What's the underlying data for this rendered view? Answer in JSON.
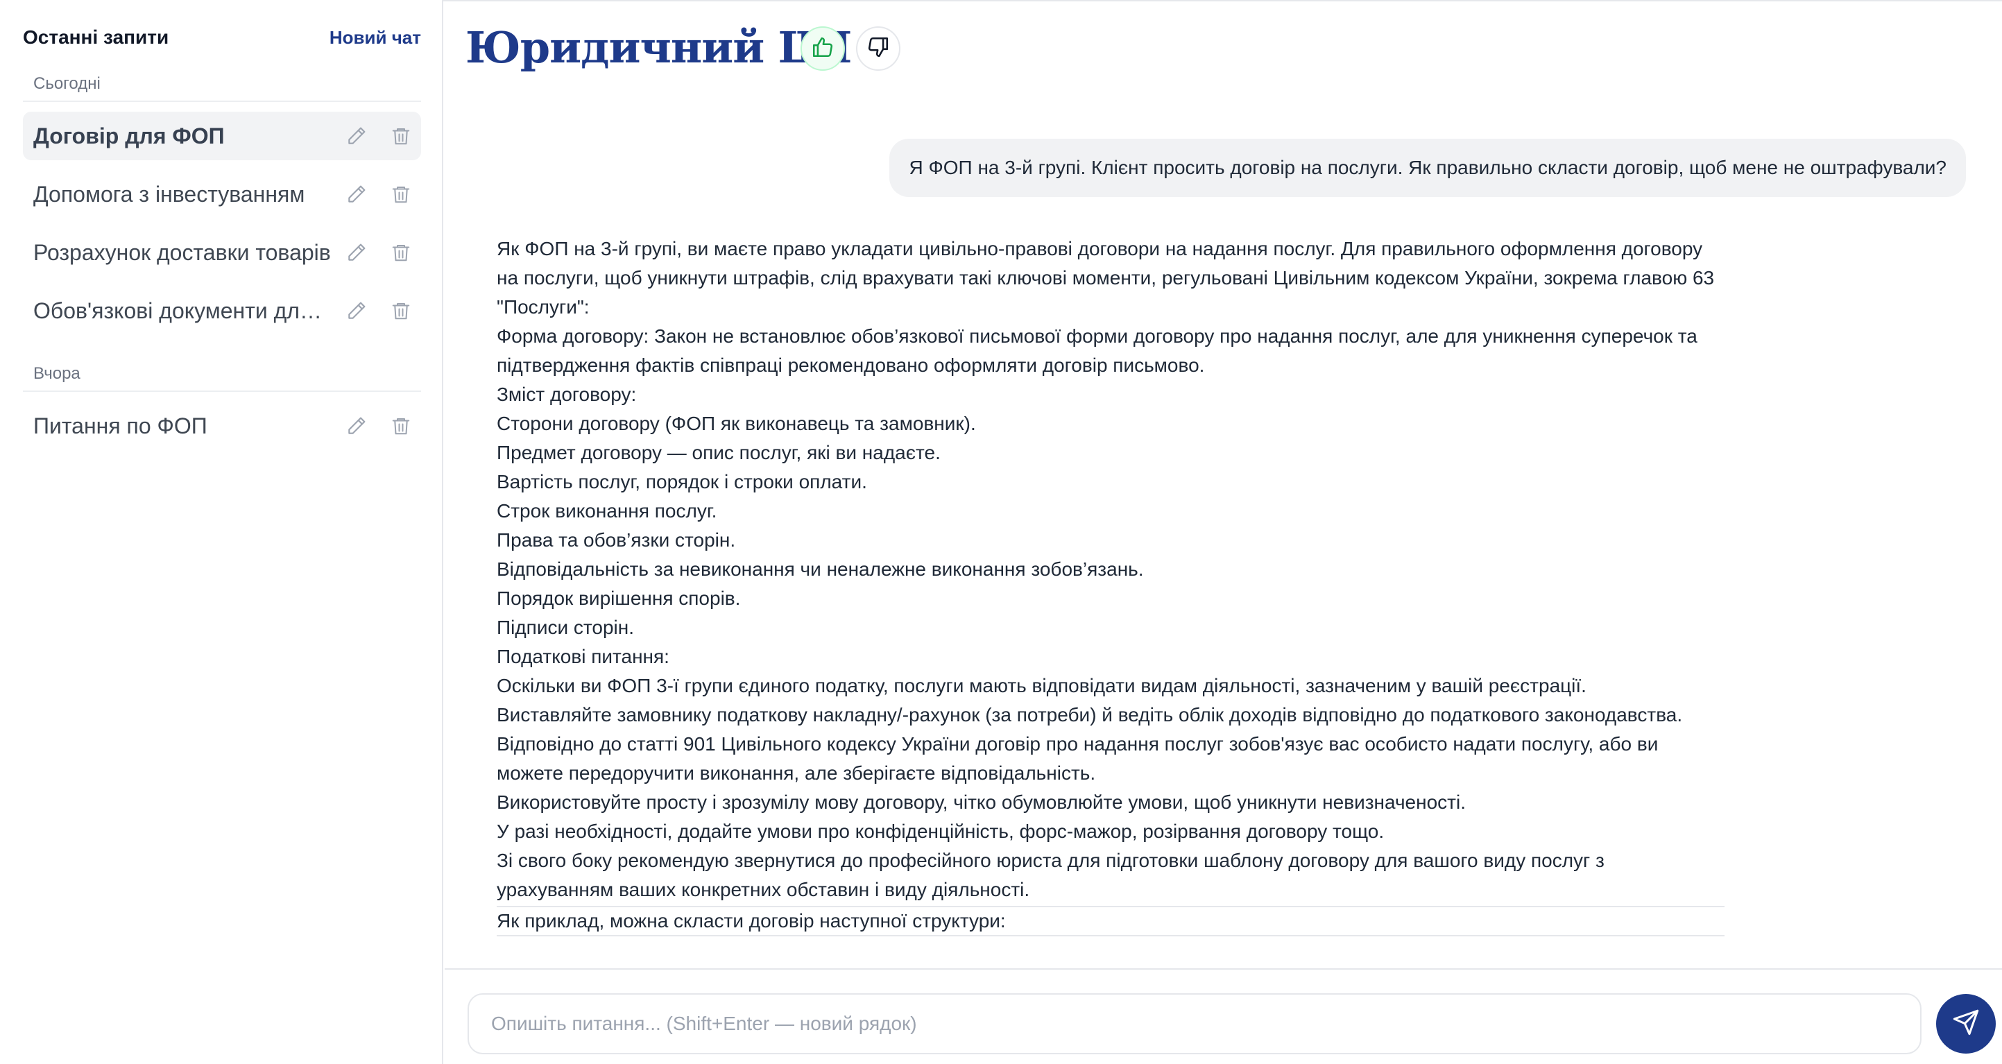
{
  "sidebar": {
    "title": "Останні запити",
    "new_chat": "Новий чат",
    "groups": {
      "today": "Сьогодні",
      "yesterday": "Вчора"
    },
    "items": [
      {
        "label": "Договір для ФОП"
      },
      {
        "label": "Допомога з інвестуванням"
      },
      {
        "label": "Розрахунок доставки товарів"
      },
      {
        "label": "Обов'язкові документи для ФОП"
      },
      {
        "label": "Питання по ФОП"
      }
    ],
    "active_item": "Договір для ФОП"
  },
  "header": {
    "title": "Юридичний ШІ"
  },
  "chat": {
    "user_message": "Я ФОП на 3-й групі. Клієнт просить договір на послуги. Як правильно скласти договір, щоб мене не оштрафували?",
    "answer": [
      "Як ФОП на 3-й групі, ви маєте право укладати цивільно-правові договори на надання послуг. Для правильного оформлення договору на послуги, щоб уникнути штрафів, слід врахувати такі ключові моменти, регульовані Цивільним кодексом України, зокрема главою 63 \"Послуги\":",
      "Форма договору: Закон не встановлює обов’язкової письмової форми договору про надання послуг, але для уникнення суперечок та підтвердження фактів співпраці рекомендовано оформляти договір письмово.",
      "Зміст договору:",
      "Сторони договору (ФОП як виконавець та замовник).",
      "Предмет договору — опис послуг, які ви надаєте.",
      "Вартість послуг, порядок і строки оплати.",
      "Строк виконання послуг.",
      "Права та обов’язки сторін.",
      "Відповідальність за невиконання чи неналежне виконання зобов’язань.",
      "Порядок вирішення спорів.",
      "Підписи сторін.",
      "Податкові питання:",
      "Оскільки ви ФОП 3-ї групи єдиного податку, послуги мають відповідати видам діяльності, зазначеним у вашій реєстрації.",
      "Виставляйте замовнику податкову накладну/-рахунок (за потреби) й ведіть облік доходів відповідно до податкового законодавства.",
      "Відповідно до статті 901 Цивільного кодексу України договір про надання послуг зобов'язує вас особисто надати послугу, або ви можете передоручити виконання, але зберігаєте відповідальність.",
      "Використовуйте просту і зрозумілу мову договору, чітко обумовлюйте умови, щоб уникнути невизначеності.",
      "У разі необхідності, додайте умови про конфіденційність, форс-мажор, розірвання договору тощо.",
      "Зі свого боку рекомендую звернутися до професійного юриста для підготовки шаблону договору для вашого виду послуг з урахуванням ваших конкретних обставин і виду діяльності.",
      "Як приклад, можна скласти договір наступної структури:"
    ]
  },
  "composer": {
    "placeholder": "Опишіть питання... (Shift+Enter — новий рядок)",
    "value": ""
  },
  "icons": {
    "edit": "pencil-icon",
    "delete": "trash-icon",
    "like": "thumbs-up-icon",
    "dislike": "thumbs-down-icon",
    "send": "paper-plane-icon"
  },
  "colors": {
    "brand": "#1e3a8a",
    "like_accent": "#16a34a",
    "muted": "#9ca3af"
  }
}
